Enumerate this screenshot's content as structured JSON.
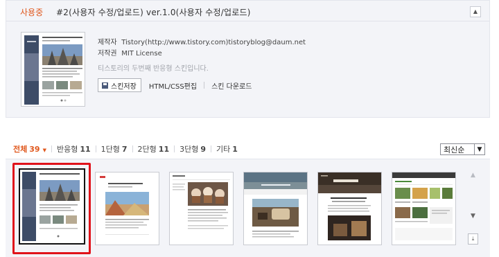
{
  "current": {
    "status": "사용중",
    "name": "#2(사용자 수정/업로드) ver.1.0(사용자 수정/업로드)",
    "maker_label": "제작자",
    "maker_value": "Tistory(http://www.tistory.com)tistoryblog@daum.net",
    "copyright_label": "저작권",
    "copyright_value": "MIT License",
    "description": "티스토리의 두번째 반응형 스킨입니다.",
    "collapse_icon": "▲"
  },
  "actions": {
    "save": "스킨저장",
    "edit": "HTML/CSS편집",
    "download": "스킨 다운로드"
  },
  "filters": [
    {
      "label": "전체",
      "count": "39"
    },
    {
      "label": "반응형",
      "count": "11"
    },
    {
      "label": "1단형",
      "count": "7"
    },
    {
      "label": "2단형",
      "count": "11"
    },
    {
      "label": "3단형",
      "count": "9"
    },
    {
      "label": "기타",
      "count": "1"
    }
  ],
  "filter_caret": "▼",
  "sort": {
    "value": "최신순",
    "arrow": "▼"
  },
  "scroll": {
    "up": "▲",
    "down": "▼",
    "end": "⤓"
  },
  "colors": {
    "accent": "#e0571c",
    "selection": "#e0121a",
    "panel_bg": "#f3f4f8"
  }
}
